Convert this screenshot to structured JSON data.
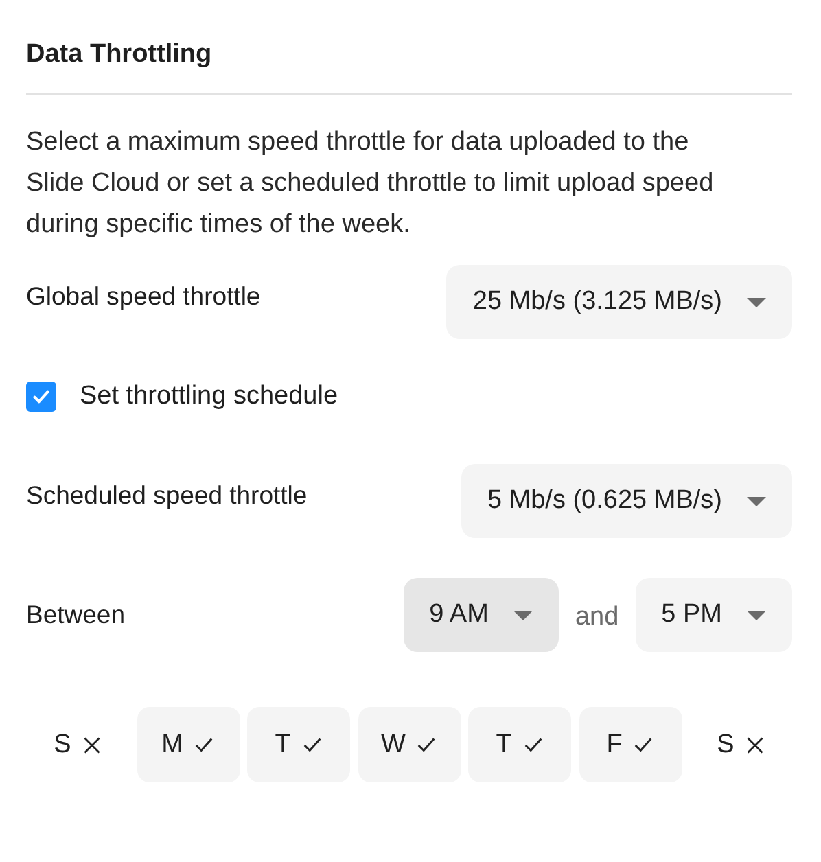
{
  "title": "Data Throttling",
  "description": "Select a maximum speed throttle for data uploaded to the Slide Cloud or set a scheduled throttle to limit upload speed during specific times of the week.",
  "global_throttle": {
    "label": "Global speed throttle",
    "value": "25 Mb/s (3.125 MB/s)"
  },
  "schedule": {
    "label": "Set throttling schedule",
    "checked": true
  },
  "scheduled_throttle": {
    "label": "Scheduled speed throttle",
    "value": "5 Mb/s (0.625 MB/s)"
  },
  "between": {
    "label": "Between",
    "start": {
      "value": "9 AM",
      "highlighted": true
    },
    "joiner": "and",
    "end": {
      "value": "5 PM",
      "highlighted": false
    }
  },
  "days": [
    {
      "label": "S",
      "selected": false
    },
    {
      "label": "M",
      "selected": true
    },
    {
      "label": "T",
      "selected": true
    },
    {
      "label": "W",
      "selected": true
    },
    {
      "label": "T",
      "selected": true
    },
    {
      "label": "F",
      "selected": true
    },
    {
      "label": "S",
      "selected": false
    }
  ]
}
